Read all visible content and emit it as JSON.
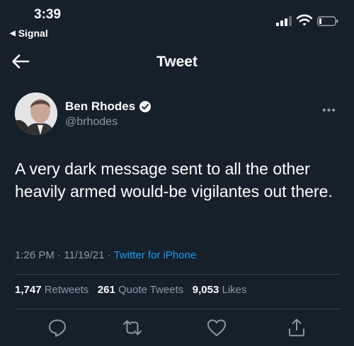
{
  "status_bar": {
    "time": "3:39",
    "back_app": "Signal"
  },
  "nav": {
    "title": "Tweet"
  },
  "tweet": {
    "author_name": "Ben Rhodes",
    "author_handle": "@brhodes",
    "text": "A very dark message sent to all the other heavily armed would-be vigilantes out there.",
    "time": "1:26 PM",
    "date": "11/19/21",
    "source": "Twitter for iPhone",
    "separator": " · "
  },
  "stats": {
    "retweets_count": "1,747",
    "retweets_label": "Retweets",
    "quote_count": "261",
    "quote_label": "Quote Tweets",
    "likes_count": "9,053",
    "likes_label": "Likes"
  },
  "icons": {
    "back": "arrow-left-icon",
    "verified": "verified-badge-icon",
    "more": "more-dots-icon",
    "reply": "reply-icon",
    "retweet": "retweet-icon",
    "like": "heart-icon",
    "share": "share-icon"
  },
  "colors": {
    "background": "#15202b",
    "secondary_text": "#8899a6",
    "link": "#1d9bf0",
    "divider": "#38444d"
  }
}
